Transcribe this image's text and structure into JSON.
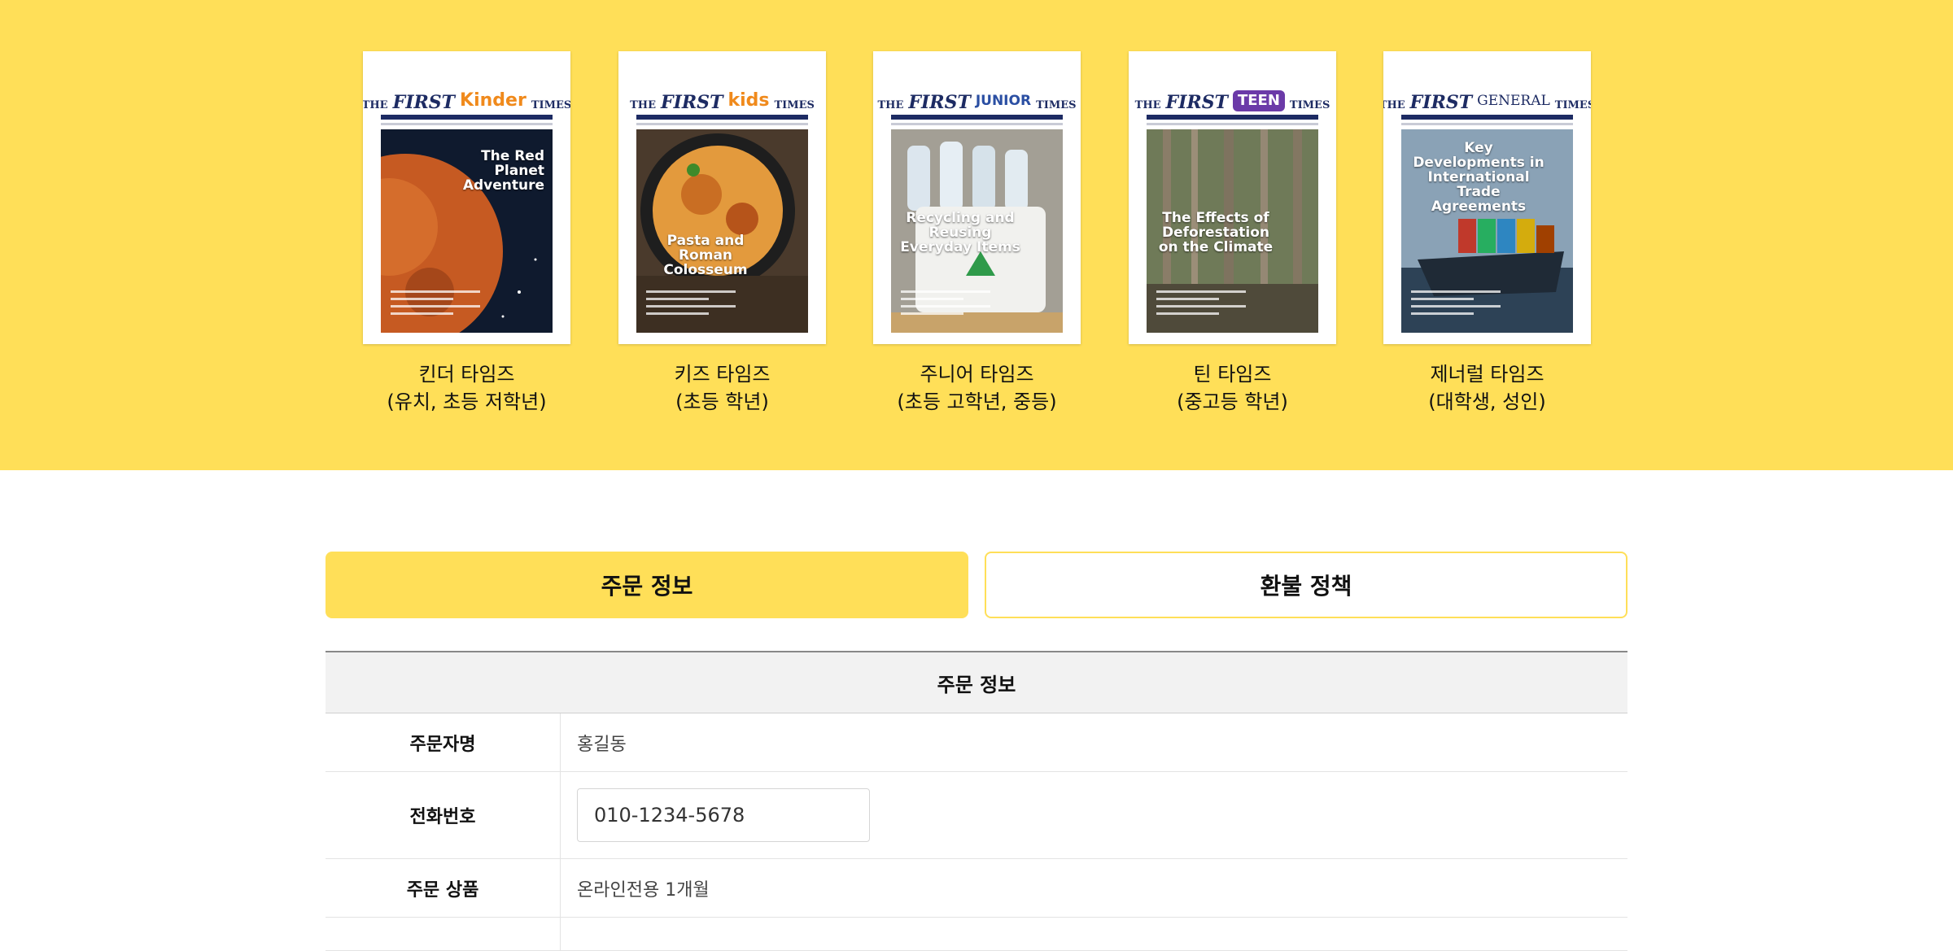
{
  "magazines": [
    {
      "mast_sub": "Kinder",
      "cover_headline": "The Red Planet Adventure",
      "caption_line1": "킨더 타임즈",
      "caption_line2": "(유치, 초등 저학년)"
    },
    {
      "mast_sub": "kids",
      "cover_headline": "Pasta and Roman Colosseum",
      "caption_line1": "키즈 타임즈",
      "caption_line2": "(초등 학년)"
    },
    {
      "mast_sub": "JUNIOR",
      "cover_headline": "Recycling and Reusing Everyday Items",
      "caption_line1": "주니어 타임즈",
      "caption_line2": "(초등 고학년, 중등)"
    },
    {
      "mast_sub": "TEEN",
      "cover_headline": "The Effects of Deforestation on the Climate",
      "caption_line1": "틴 타임즈",
      "caption_line2": "(중고등 학년)"
    },
    {
      "mast_sub": "GENERAL",
      "cover_headline": "Key Developments in International Trade Agreements",
      "caption_line1": "제너럴 타임즈",
      "caption_line2": "(대학생, 성인)"
    }
  ],
  "mast_common": {
    "the": "THE",
    "first": "FIRST",
    "times": "TIMES"
  },
  "tabs": {
    "order_info": "주문 정보",
    "refund_policy": "환불 정책"
  },
  "order_table": {
    "heading": "주문 정보",
    "rows": [
      {
        "label": "주문자명",
        "value": "홍길동"
      },
      {
        "label": "전화번호",
        "value": "010-1234-5678"
      },
      {
        "label": "주문 상품",
        "value": "온라인전용 1개월"
      }
    ]
  },
  "colors": {
    "accent": "#ffdf58",
    "navy": "#1d2b63"
  }
}
